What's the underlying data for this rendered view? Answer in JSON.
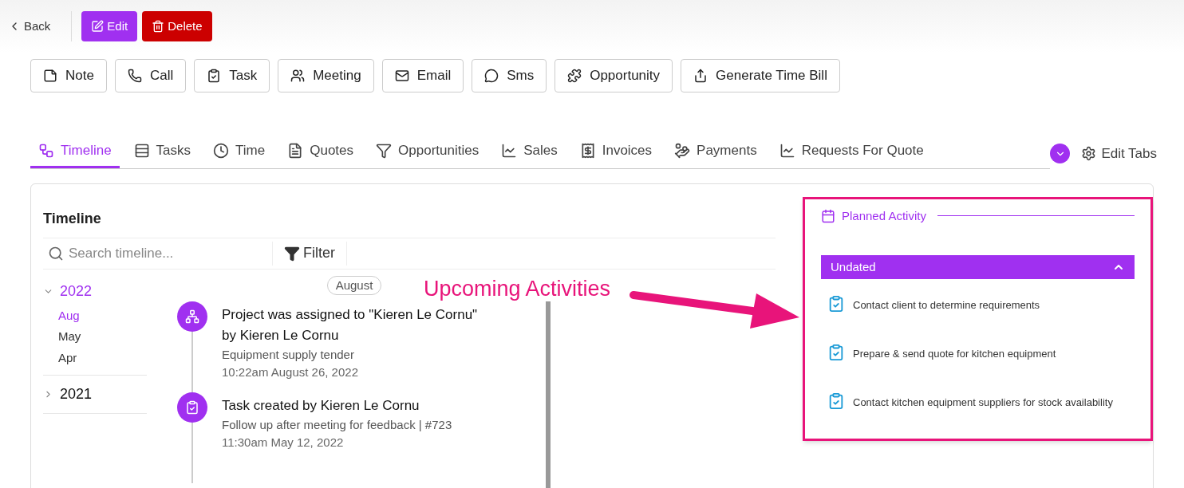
{
  "header": {
    "back": "Back",
    "edit": "Edit",
    "delete": "Delete"
  },
  "actions": [
    {
      "label": "Note",
      "kind": "note"
    },
    {
      "label": "Call",
      "kind": "call"
    },
    {
      "label": "Task",
      "kind": "task"
    },
    {
      "label": "Meeting",
      "kind": "meeting"
    },
    {
      "label": "Email",
      "kind": "email"
    },
    {
      "label": "Sms",
      "kind": "sms"
    },
    {
      "label": "Opportunity",
      "kind": "opportunity"
    },
    {
      "label": "Generate Time Bill",
      "kind": "bill"
    }
  ],
  "tabs": [
    {
      "label": "Timeline",
      "kind": "timeline",
      "selected": true
    },
    {
      "label": "Tasks",
      "kind": "tasks",
      "selected": false
    },
    {
      "label": "Time",
      "kind": "time",
      "selected": false
    },
    {
      "label": "Quotes",
      "kind": "quotes",
      "selected": false
    },
    {
      "label": "Opportunities",
      "kind": "opportunities",
      "selected": false
    },
    {
      "label": "Sales",
      "kind": "sales",
      "selected": false
    },
    {
      "label": "Invoices",
      "kind": "invoices",
      "selected": false
    },
    {
      "label": "Payments",
      "kind": "payments",
      "selected": false
    },
    {
      "label": "Requests For Quote",
      "kind": "rfq",
      "selected": false
    }
  ],
  "edit_tabs": "Edit Tabs",
  "timeline": {
    "title": "Timeline",
    "search_placeholder": "Search timeline...",
    "filter": "Filter",
    "years": [
      {
        "label": "2022",
        "expanded": true,
        "selected": true,
        "months": [
          {
            "label": "Aug",
            "selected": true
          },
          {
            "label": "May",
            "selected": false
          },
          {
            "label": "Apr",
            "selected": false
          }
        ]
      },
      {
        "label": "2021",
        "expanded": false,
        "selected": false
      }
    ],
    "month_badge": "August",
    "events": [
      {
        "kind": "project",
        "title": "Project was assigned to \"Kieren Le Cornu\" by Kieren Le Cornu",
        "subtitle": "Equipment supply tender",
        "time": "10:22am August 26, 2022"
      },
      {
        "kind": "task",
        "title": "Task created by Kieren Le Cornu",
        "subtitle": "Follow up after meeting for feedback | #723",
        "time": "11:30am May 12, 2022"
      }
    ]
  },
  "planned": {
    "title": "Planned Activity",
    "group": {
      "label": "Undated",
      "expanded": true
    },
    "items": [
      "Contact client to determine requirements",
      "Prepare & send quote for kitchen equipment",
      "Contact kitchen equipment suppliers for stock availability"
    ]
  },
  "annotation": {
    "text": "Upcoming Activities"
  }
}
